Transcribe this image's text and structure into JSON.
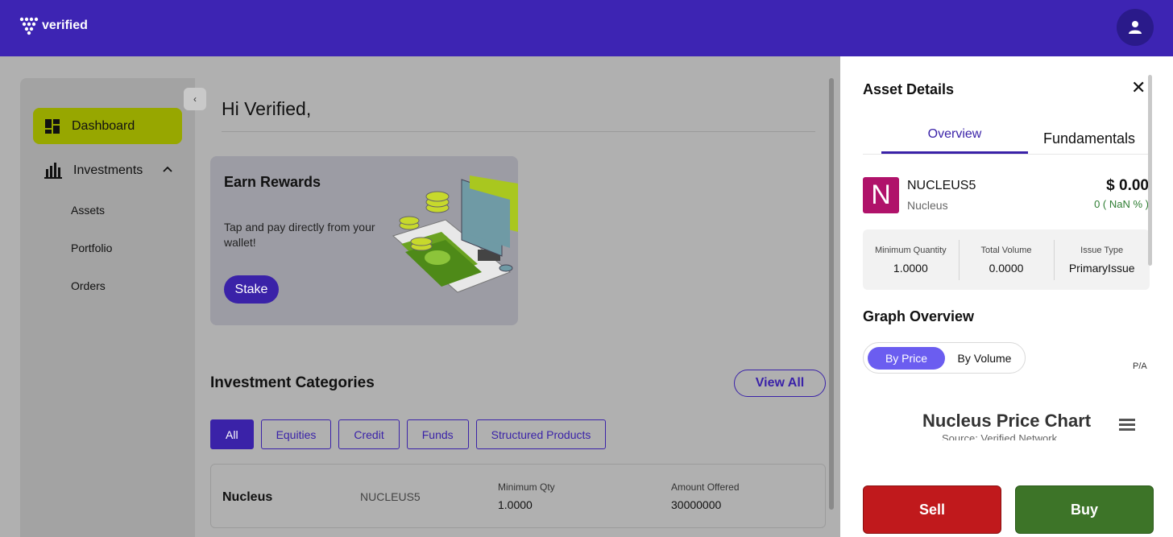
{
  "header": {
    "brand": "verified"
  },
  "sidebar": {
    "items": [
      {
        "label": "Dashboard"
      },
      {
        "label": "Investments"
      }
    ],
    "sub_items": [
      "Assets",
      "Portfolio",
      "Orders"
    ]
  },
  "main": {
    "greeting": "Hi Verified,",
    "rewards": {
      "title": "Earn Rewards",
      "text": "Tap and pay directly from your wallet!",
      "button": "Stake"
    },
    "categories": {
      "title": "Investment Categories",
      "view_all": "View All",
      "chips": [
        "All",
        "Equities",
        "Credit",
        "Funds",
        "Structured Products"
      ]
    },
    "row": {
      "name": "Nucleus",
      "symbol": "NUCLEUS5",
      "min_qty_label": "Minimum Qty",
      "min_qty_value": "1.0000",
      "amount_label": "Amount Offered",
      "amount_value": "30000000"
    }
  },
  "panel": {
    "title": "Asset Details",
    "tabs": [
      "Overview",
      "Fundamentals"
    ],
    "asset": {
      "logo_letter": "N",
      "symbol": "NUCLEUS5",
      "name": "Nucleus",
      "price": "$ 0.00",
      "change": "0 ( NaN % )"
    },
    "stats": [
      {
        "label": "Minimum Quantity",
        "value": "1.0000"
      },
      {
        "label": "Total Volume",
        "value": "0.0000"
      },
      {
        "label": "Issue Type",
        "value": "PrimaryIssue"
      }
    ],
    "graph": {
      "title": "Graph Overview",
      "by_price": "By Price",
      "by_volume": "By Volume",
      "pa": "P/A",
      "chart_title": "Nucleus Price Chart",
      "chart_subtitle": "Source: Verified Network"
    },
    "sell": "Sell",
    "buy": "Buy"
  },
  "colors": {
    "brand": "#3d24b3",
    "dashboard_active": "#97a700",
    "sell": "#c0191c",
    "buy": "#3d7428",
    "asset_logo": "#b0126a"
  }
}
